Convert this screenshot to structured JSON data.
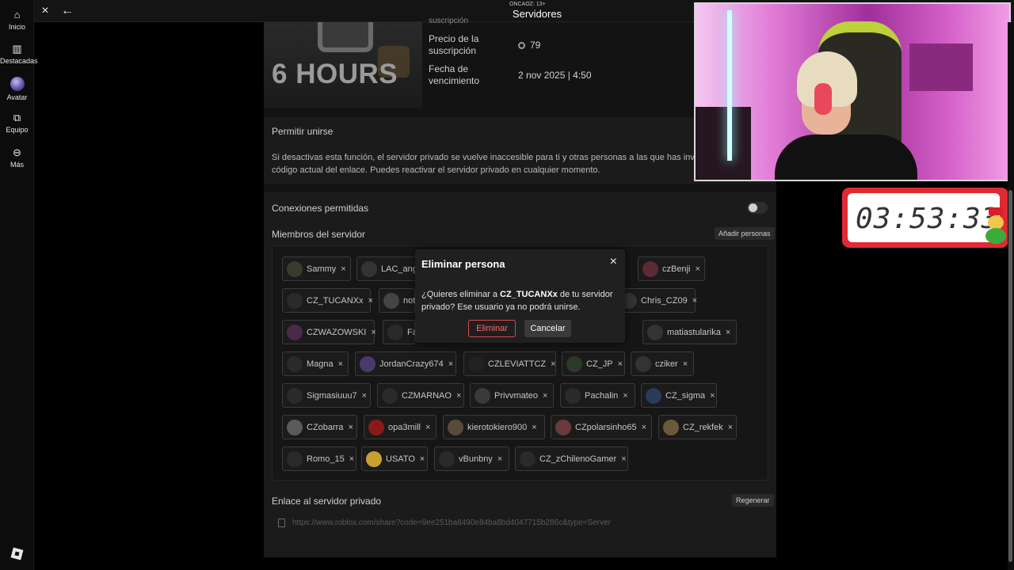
{
  "nav": {
    "items": [
      {
        "label": "Inicio",
        "icon": "home-icon"
      },
      {
        "label": "Destacadas",
        "icon": "charts-icon"
      },
      {
        "label": "Avatar",
        "icon": "avatar-icon"
      },
      {
        "label": "Equipo",
        "icon": "inventory-icon"
      },
      {
        "label": "Más",
        "icon": "more-icon"
      }
    ]
  },
  "topbar": {
    "rating": "ONCAOZ: 13+",
    "title": "Servidores",
    "close_icon": "×",
    "back_icon": "←"
  },
  "server": {
    "thumbnail_text": "6 HOURS",
    "subscription_label_partial": "suscripción",
    "price_label": "Precio de la suscripción",
    "price_value": "79",
    "expiry_label": "Fecha de vencimiento",
    "expiry_value": "2 nov 2025 | 4:50"
  },
  "allow_join": {
    "title": "Permitir unirse",
    "description_line1": "Si desactivas esta función, el servidor privado se vuelve inaccesible para ti y otras personas a las que has invit",
    "description_line2": "código actual del enlace. Puedes reactivar el servidor privado en cualquier momento."
  },
  "connections": {
    "title": "Conexiones permitidas",
    "toggle_on": false
  },
  "members": {
    "title": "Miembros del servidor",
    "add_button": "Añadir personas",
    "list": [
      "Sammy",
      "LAC_ang",
      "czBenji",
      "CZ_TUCANXx",
      "not",
      "Chris_CZ09",
      "CZWAZOWSKI",
      "Fa",
      "matiastularika",
      "Magna",
      "JordanCrazy674",
      "CZLEVIATTCZ",
      "CZ_JP",
      "cziker",
      "Sigmasiuuu7",
      "CZMARNAO",
      "Privvmateo",
      "Pachalin",
      "CZ_sigma",
      "CZobarra",
      "opa3mill",
      "kierotokiero900",
      "CZpolarsinho65",
      "CZ_rekfek",
      "Romo_15",
      "USATO",
      "vBunbny",
      "CZ_zChilenoGamer"
    ],
    "remove_symbol": "×"
  },
  "private_link": {
    "title": "Enlace al servidor privado",
    "regenerate_button": "Regenerar",
    "url": "https://www.roblox.com/share?code=9ee251ba8490e84ba8bd4047715b286c&type=Server"
  },
  "modal": {
    "title": "Eliminar persona",
    "body_before": "¿Quieres eliminar a ",
    "username": "CZ_TUCANXx",
    "body_after": " de tu servidor privado? Ese usuario ya no podrá unirse.",
    "delete_button": "Eliminar",
    "cancel_button": "Cancelar",
    "close_icon": "×"
  },
  "overlay": {
    "timer": "03:53:33"
  },
  "colors": {
    "background": "#000000",
    "panel": "#1b1b1c",
    "danger": "#d84a4a",
    "timer_frame": "#e02a33"
  }
}
